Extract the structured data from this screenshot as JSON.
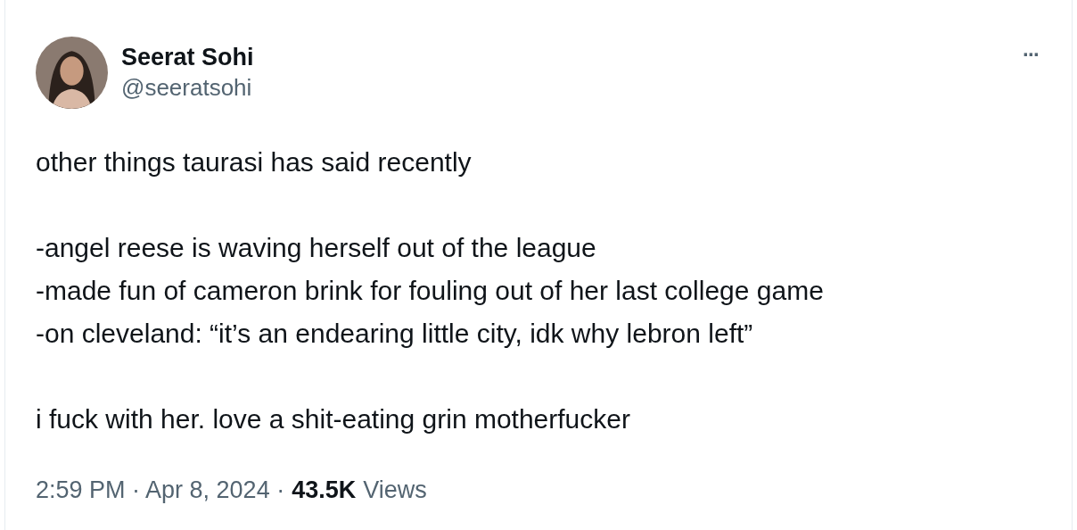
{
  "author": {
    "name": "Seerat Sohi",
    "handle": "@seeratsohi"
  },
  "more_menu": "···",
  "paragraphs": [
    [
      "other things taurasi has said recently"
    ],
    [
      "-angel reese is waving herself out of the league",
      "-made fun of cameron brink for fouling out of her last college game",
      "-on cleveland: “it’s an endearing little city, idk why lebron left”"
    ],
    [
      "i fuck with her. love a shit-eating grin motherfucker"
    ]
  ],
  "footer": {
    "timestamp": "2:59 PM · Apr 8, 2024 ·",
    "views_count": "43.5K",
    "views_label": "Views"
  }
}
